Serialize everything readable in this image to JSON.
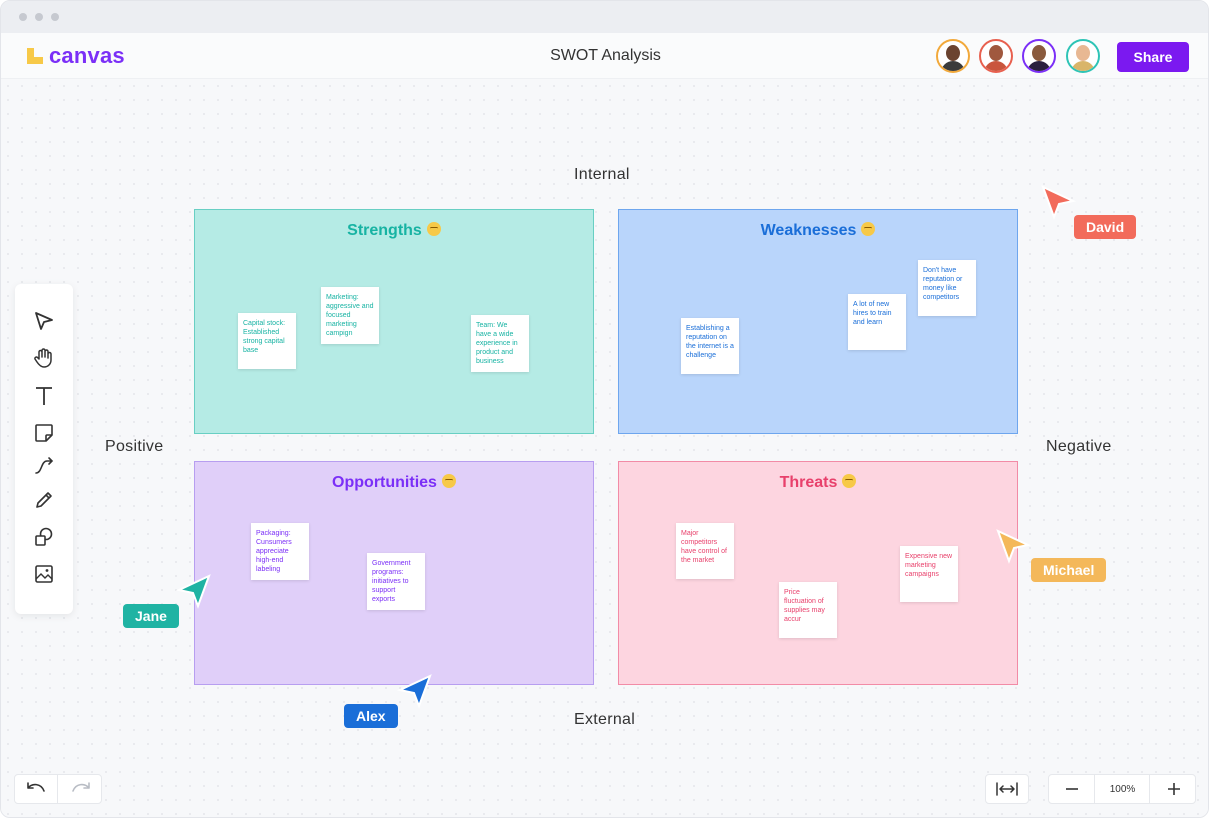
{
  "app": {
    "name": "canvas",
    "document_title": "SWOT Analysis",
    "share_label": "Share"
  },
  "collaborators": [
    {
      "name": "avatar-1",
      "ring": "#f2a93b"
    },
    {
      "name": "avatar-2",
      "ring": "#e8604f"
    },
    {
      "name": "avatar-3",
      "ring": "#7b2ff7"
    },
    {
      "name": "avatar-4",
      "ring": "#2ec4b6"
    }
  ],
  "axes": {
    "top": "Internal",
    "bottom": "External",
    "left": "Positive",
    "right": "Negative"
  },
  "quadrants": {
    "strengths": {
      "title": "Strengths",
      "notes": [
        "Capital stock: Established strong capital base",
        "Marketing: aggressive and focused marketing campign",
        "Team: We have a wide experience in product and business"
      ]
    },
    "weaknesses": {
      "title": "Weaknesses",
      "notes": [
        "Establishing a reputation on the internet is a challenge",
        "A lot of new hires to train and learn",
        "Don't have reputation or money like competitors"
      ]
    },
    "opportunities": {
      "title": "Opportunities",
      "notes": [
        "Packaging: Cunsumers appreciate high-end labeling",
        "Government programs: initiatives to support exports"
      ]
    },
    "threats": {
      "title": "Threats",
      "notes": [
        "Major competitors have control of the market",
        "Price fluctuation of supplies may accur",
        "Expensive new marketing campaigns"
      ]
    }
  },
  "cursors": {
    "david": "David",
    "michael": "Michael",
    "jane": "Jane",
    "alex": "Alex"
  },
  "tools": [
    "select-tool",
    "hand-tool",
    "text-tool",
    "sticky-note-tool",
    "connector-tool",
    "pen-tool",
    "shapes-tool",
    "image-tool"
  ],
  "zoom": {
    "level": "100%"
  },
  "colors": {
    "brand": "#7b2ff7",
    "strengths": "#2ec4b6",
    "weaknesses": "#1a6ed8",
    "opportunities": "#7b2ff7",
    "threats": "#e8406b"
  }
}
